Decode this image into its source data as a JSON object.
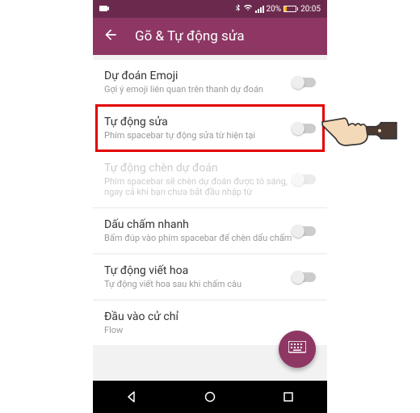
{
  "status": {
    "battery_pct": "20%",
    "time": "20:05"
  },
  "header": {
    "title": "Gõ & Tự động sửa"
  },
  "settings": [
    {
      "title": "Dự đoán Emoji",
      "sub": "Gợi ý emoji liên quan trên thanh dự đoán",
      "disabled": false,
      "toggle": true,
      "highlight": false
    },
    {
      "title": "Tự động sửa",
      "sub": "Phím spacebar tự động sửa từ hiện tại",
      "disabled": false,
      "toggle": true,
      "highlight": true
    },
    {
      "title": "Tự động chèn dự đoán",
      "sub": "Phím spacebar sẽ chèn dự đoán được tô sáng, ngay cả khi bạn chưa bắt đầu nhập từ",
      "disabled": true,
      "toggle": true,
      "highlight": false
    },
    {
      "title": "Dấu chấm nhanh",
      "sub": "Bấm đúp vào phím spacebar để chèn dấu chấm",
      "disabled": false,
      "toggle": true,
      "highlight": false
    },
    {
      "title": "Tự động viết hoa",
      "sub": "Tự động viết hoa sau khi chấm câu",
      "disabled": false,
      "toggle": true,
      "highlight": false
    },
    {
      "title": "Đầu vào cử chỉ",
      "sub": "Flow",
      "disabled": false,
      "toggle": false,
      "highlight": false
    }
  ]
}
